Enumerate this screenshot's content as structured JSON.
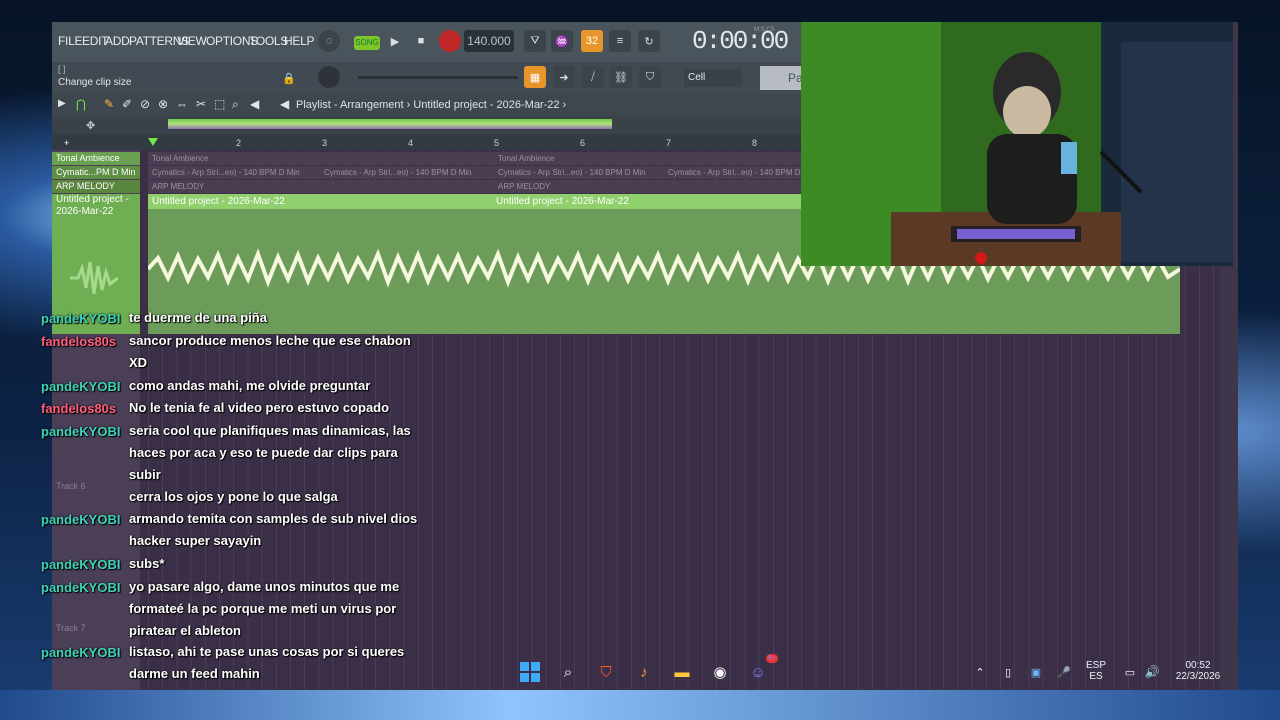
{
  "menu": [
    "FILE",
    "EDIT",
    "ADD",
    "PATTERNS",
    "VIEW",
    "OPTIONS",
    "TOOLS",
    "HELP"
  ],
  "toolbar": {
    "song_mode": "SONG",
    "tempo": "140.000",
    "time": "0:00:00",
    "time_unit": "M:S:CS",
    "hint_brackets": "[    ]",
    "hint": "Change clip size",
    "snap": "Cell",
    "pattern": "Pa",
    "counter": "32"
  },
  "playlist": {
    "breadcrumb": "Playlist - Arrangement › Untitled project - 2026-Mar-22 ›",
    "ruler": [
      "2",
      "3",
      "4",
      "5",
      "6",
      "7",
      "8"
    ]
  },
  "tracks": [
    {
      "name": "Tonal Ambience"
    },
    {
      "name": "Cymatic...PM D Min"
    },
    {
      "name": "ARP MELODY"
    },
    {
      "name": "Untitled project - 2026-Mar-22"
    },
    {
      "name": "Track 6"
    },
    {
      "name": "Track 7"
    }
  ],
  "lanes": {
    "tonal": [
      "Tonal Ambience",
      "Tonal Ambience"
    ],
    "cymatics": [
      "Cymatics - Arp Stri...eo) - 140 BPM D Min",
      "Cymatics - Arp Stri...eo) - 140 BPM D Min",
      "Cymatics - Arp Stri...eo) - 140 BPM D Min",
      "Cymatics - Arp Stri...eo) - 140 BPM D Min"
    ],
    "arp": [
      "ARP MELODY",
      "ARP MELODY"
    ],
    "audio_clips": [
      "Untitled project - 2026-Mar-22",
      "Untitled project - 2026-Mar-22"
    ]
  },
  "chat": [
    {
      "user": "pandeKYOBI",
      "color": "#3fd3b8",
      "lines": [
        "te duerme de una piña"
      ]
    },
    {
      "user": "fandelos80s",
      "color": "#ff5f7e",
      "lines": [
        "sancor produce menos leche que ese chabon",
        "XD"
      ]
    },
    {
      "user": "pandeKYOBI",
      "color": "#3fd3b8",
      "lines": [
        "como andas mahi, me olvide preguntar"
      ]
    },
    {
      "user": "fandelos80s",
      "color": "#ff5f7e",
      "lines": [
        "No le tenia fe al video pero estuvo copado"
      ]
    },
    {
      "user": "pandeKYOBI",
      "color": "#3fd3b8",
      "lines": [
        "seria cool que planifiques mas dinamicas, las",
        "haces por aca y eso te puede dar clips para",
        "subir"
      ]
    },
    {
      "user": "",
      "color": "#c0305a",
      "lines": [
        "cerra los ojos y pone lo que salga"
      ]
    },
    {
      "user": "pandeKYOBI",
      "color": "#3fd3b8",
      "lines": [
        "armando temita con samples de sub nivel dios",
        "hacker super sayayin"
      ]
    },
    {
      "user": "pandeKYOBI",
      "color": "#3fd3b8",
      "lines": [
        "subs*"
      ]
    },
    {
      "user": "pandeKYOBI",
      "color": "#3fd3b8",
      "lines": [
        "yo pasare algo, dame unos minutos que me",
        "formateé la pc porque me meti un virus por",
        "piratear el ableton"
      ]
    },
    {
      "user": "pandeKYOBI",
      "color": "#3fd3b8",
      "lines": [
        "listaso, ahi te pase unas cosas por si queres",
        "darme un feed mahin"
      ]
    }
  ],
  "taskbar": {
    "lang": "ESP",
    "lang_sub": "ES",
    "clock_time": "00:52",
    "clock_date": "22/3/2026",
    "discord_badge": "9+"
  }
}
